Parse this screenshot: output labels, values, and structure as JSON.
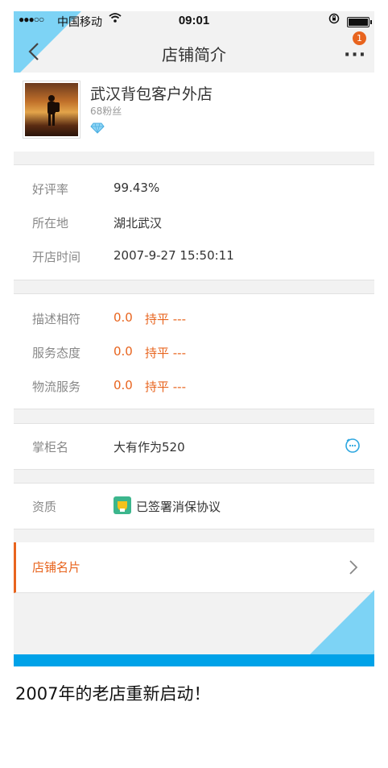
{
  "status_bar": {
    "signal": "●●●○○",
    "carrier": "中国移动",
    "wifi_icon": "wifi-icon",
    "time": "09:01",
    "lock_icon": "rotation-lock-icon"
  },
  "nav": {
    "title": "店铺简介",
    "badge_count": "1",
    "more_label": "···"
  },
  "shop": {
    "name": "武汉背包客户外店",
    "fans": "68粉丝",
    "level_icon": "diamond-icon"
  },
  "stats": [
    {
      "label": "好评率",
      "value": "99.43%"
    },
    {
      "label": "所在地",
      "value": "湖北武汉"
    },
    {
      "label": "开店时间",
      "value": "2007-9-27 15:50:11"
    }
  ],
  "ratings": [
    {
      "label": "描述相符",
      "score": "0.0",
      "trend": "持平 ---"
    },
    {
      "label": "服务态度",
      "score": "0.0",
      "trend": "持平 ---"
    },
    {
      "label": "物流服务",
      "score": "0.0",
      "trend": "持平 ---"
    }
  ],
  "owner": {
    "label": "掌柜名",
    "value": "大有作为520"
  },
  "qualification": {
    "label": "资质",
    "value": "已签署消保协议"
  },
  "shop_card": {
    "label": "店铺名片"
  },
  "caption": "2007年的老店重新启动！",
  "colors": {
    "accent": "#e8641e",
    "corner": "#7dd3f5",
    "bar": "#00a2e8"
  }
}
